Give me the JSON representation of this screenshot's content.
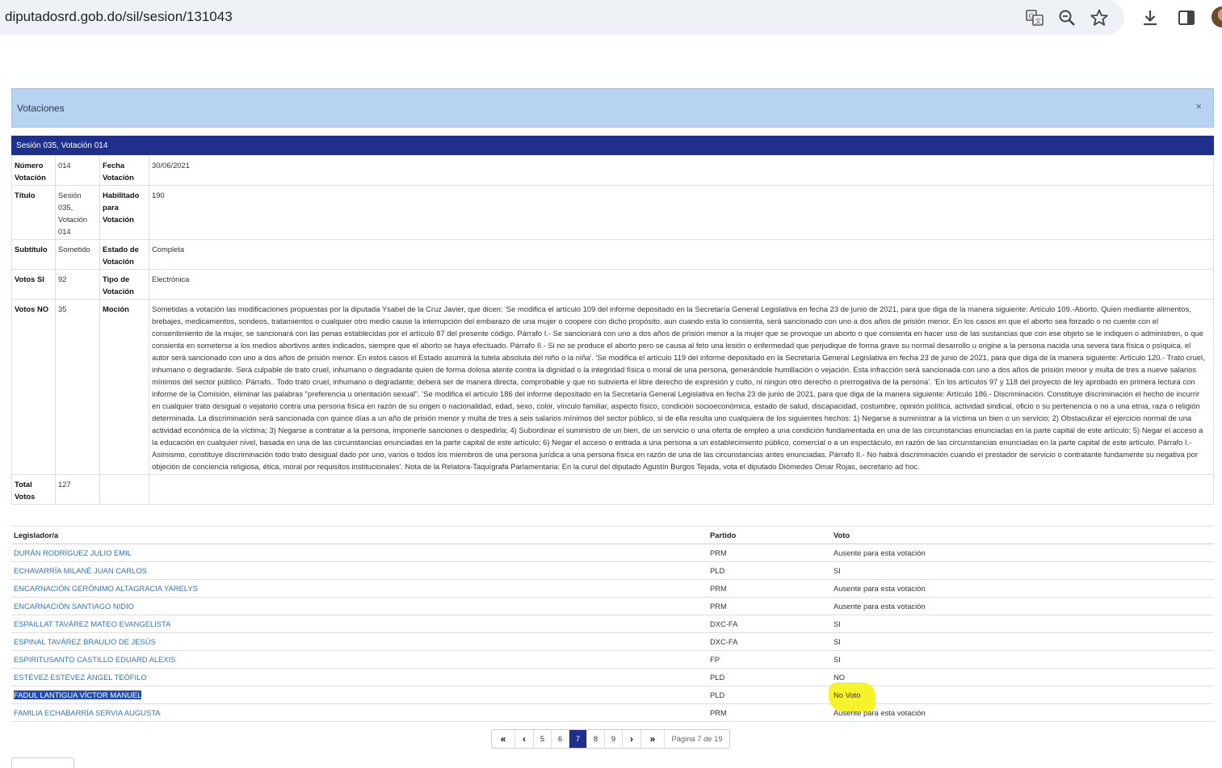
{
  "browser": {
    "url": "diputadosrd.gob.do/sil/sesion/131043"
  },
  "panel": {
    "title": "Votaciones",
    "close": "×"
  },
  "session": {
    "band": "Sesión 035, Votación 014"
  },
  "info": {
    "numero_label": "Número Votación",
    "numero_value": "014",
    "fecha_label": "Fecha Votación",
    "fecha_value": "30/06/2021",
    "titulo_label": "Título",
    "titulo_value": "Sesión 035, Votación 014",
    "habilitado_label": "Habilitado para Votación",
    "habilitado_value": "190",
    "subtitulo_label": "Subtitulo",
    "subtitulo_value": "Sometido",
    "estado_label": "Estado de Votación",
    "estado_value": "Completa",
    "votos_si_label": "Votos SI",
    "votos_si_value": "92",
    "tipo_label": "Tipo de Votación",
    "tipo_value": "Electrónica",
    "votos_no_label": "Votos NO",
    "votos_no_value": "35",
    "mocion_label": "Moción",
    "mocion_value": "Sometidas a votación las modificaciones propuestas por la diputada Ysabel de la Cruz Javier, que dicen: 'Se modifica el artículo 109 del informe depositado en la Secretaría General Legislativa en fecha 23 de junio de 2021, para que diga de la manera siguiente: Artículo 109.-Aborto. Quien mediante alimentos, brebajes, medicamentos, sondeos, tratamientos o cualquier otro medio cause la interrupción del embarazo de una mujer o coopere con dicho propósito, aun cuando esta lo consienta, será sancionado con uno a dos años de prisión menor. En los casos en que el aborto sea forzado o no cuente con el consentimiento de la mujer, se sancionará con las penas establecidas por el artículo 87 del presente código. Párrafo I.- Se sancionará con uno a dos años de prisión menor a la mujer que se provoque un aborto o que consienta en hacer uso de las sustancias que con ese objeto se le indiquen o administren, o que consienta en someterse a los medios abortivos antes indicados, siempre que el aborto se haya efectuado. Párrafo II.- Si no se produce el aborto pero se causa al feto una lesión o enfermedad que perjudique de forma grave su normal desarrollo u origine a la persona nacida una severa tara física o psíquica, el autor será sancionado con uno a dos años de prisión menor. En estos casos el Estado asumirá la tutela absoluta del niño o la niña'. 'Se modifica el artículo 119 del informe depositado en la Secretaría General Legislativa en fecha 23 de junio de 2021, para que diga de la manera siguiente: Artículo 120.- Trato cruel, inhumano o degradante. Será culpable de trato cruel, inhumano o degradante quien de forma dolosa atente contra la dignidad o la integridad física o moral de una persona, generándole humillación o vejación. Esta infracción será sancionada con uno a dos años de prisión menor y multa de tres a nueve salarios mínimos del sector público. Párrafo.. Todo trato cruel, inhumano o degradante; deberá ser de manera directa, comprobable y que no subvierta el libre derecho de expresión y culto, ni ningún otro derecho o prerrogativa de la persona'. 'En los artículos 97 y 118 del proyecto de ley aprobado en primera lectura con informe de la Comisión, eliminar las palabras \"preferencia u orientación sexual\". 'Se modifica el artículo 186 del informe depositado en la Secretaría General Legislativa en fecha 23 de junio de 2021, para que diga de la manera siguiente: Artículo 186.- Discriminación. Constituye discriminación el hecho de incurrir en cualquier trato desigual o vejatorio contra una persona física en razón de su origen o nacionalidad, edad, sexo, color, vínculo familiar, aspecto físico, condición socioeconómica, estado de salud, discapacidad, costumbre, opinión política, actividad sindical, oficio o su pertenencia o no a una etnia, raza o religión determinada. La discriminación será sancionada con quince días a un año de prisión menor y multa de tres a seis salarios mínimos del sector público, si de ella resulta uno cualquiera de los siguientes hechos: 1) Negarse a suministrar a la víctima un bien o un servicio; 2) Obstaculizar el ejercicio normal de una actividad económica de la víctima; 3) Negarse a contratar a la persona, imponerle sanciones o despedirla; 4) Subordinar el suministro de un bien, de un servicio o una oferta de empleo a una condición fundamentada en una de las circunstancias enunciadas en la parte capital de este artículo; 5) Negar el acceso a la educación en cualquier nivel, basada en una de las circunstancias enunciadas en la parte capital de este artículo; 6) Negar el acceso o entrada a una persona a un establecimiento público, comercial o a un espectáculo, en razón de las circunstancias enunciadas en la parte capital de este artículo. Párrafo I.- Asimismo, constituye discriminación todo trato desigual dado por uno, varios o todos los miembros de una persona jurídica a una persona física en razón de una de las circunstancias antes enunciadas. Párrafo II.- No habrá discriminación cuando el prestador de servicio o contratante fundamente su negativa por objeción de conciencia religiosa, ética, moral por requisitos institucionales'. Nota de la Relatora-Taquígrafa Parlamentaria: En la curul del diputado Agustín Burgos Tejada, vota el diputado Diómedes Omar Rojas, secretario ad hoc.",
    "total_label": "Total Votos",
    "total_value": "127"
  },
  "votes": {
    "headers": {
      "legislador": "Legislador/a",
      "partido": "Partido",
      "voto": "Voto"
    },
    "rows": [
      {
        "name": "DURÁN RODRÍGUEZ JULIO EMIL",
        "party": "PRM",
        "vote": "Ausente para esta votación"
      },
      {
        "name": "ECHAVARRÍA MILANÉ JUAN CARLOS",
        "party": "PLD",
        "vote": "SI"
      },
      {
        "name": "ENCARNACIÓN GERÓNIMO ALTAGRACIA YARELYS",
        "party": "PRM",
        "vote": "Ausente para esta votación"
      },
      {
        "name": "ENCARNACIÓN SANTIAGO NIDIO",
        "party": "PRM",
        "vote": "Ausente para esta votación"
      },
      {
        "name": "ESPAILLAT TAVÁREZ MATEO EVANGELISTA",
        "party": "DXC-FA",
        "vote": "SI"
      },
      {
        "name": "ESPINAL TAVÁREZ BRAULIO DE JESÚS",
        "party": "DXC-FA",
        "vote": "SI"
      },
      {
        "name": "ESPIRITUSANTO CASTILLO EDUARD ALEXIS",
        "party": "FP",
        "vote": "SI"
      },
      {
        "name": "ESTÉVEZ ESTÉVEZ ÁNGEL TEÓFILO",
        "party": "PLD",
        "vote": "NO"
      },
      {
        "name": "FADUL LANTIGUA VÍCTOR MANUEL",
        "party": "PLD",
        "vote": "No Voto"
      },
      {
        "name": "FAMILIA ECHABARRÍA SERVIA AUGUSTA",
        "party": "PRM",
        "vote": "Ausente para esta votación"
      }
    ]
  },
  "pagination": {
    "first": "«",
    "prev": "‹",
    "pages": [
      "5",
      "6",
      "7",
      "8",
      "9"
    ],
    "current": "7",
    "next": "›",
    "last": "»",
    "info": "Página 7 de 19"
  },
  "colors": {
    "band": "#1f2f8c",
    "panel_header": "#b8d3f2",
    "link": "#2f74c0",
    "highlight": "#f7f32a"
  }
}
